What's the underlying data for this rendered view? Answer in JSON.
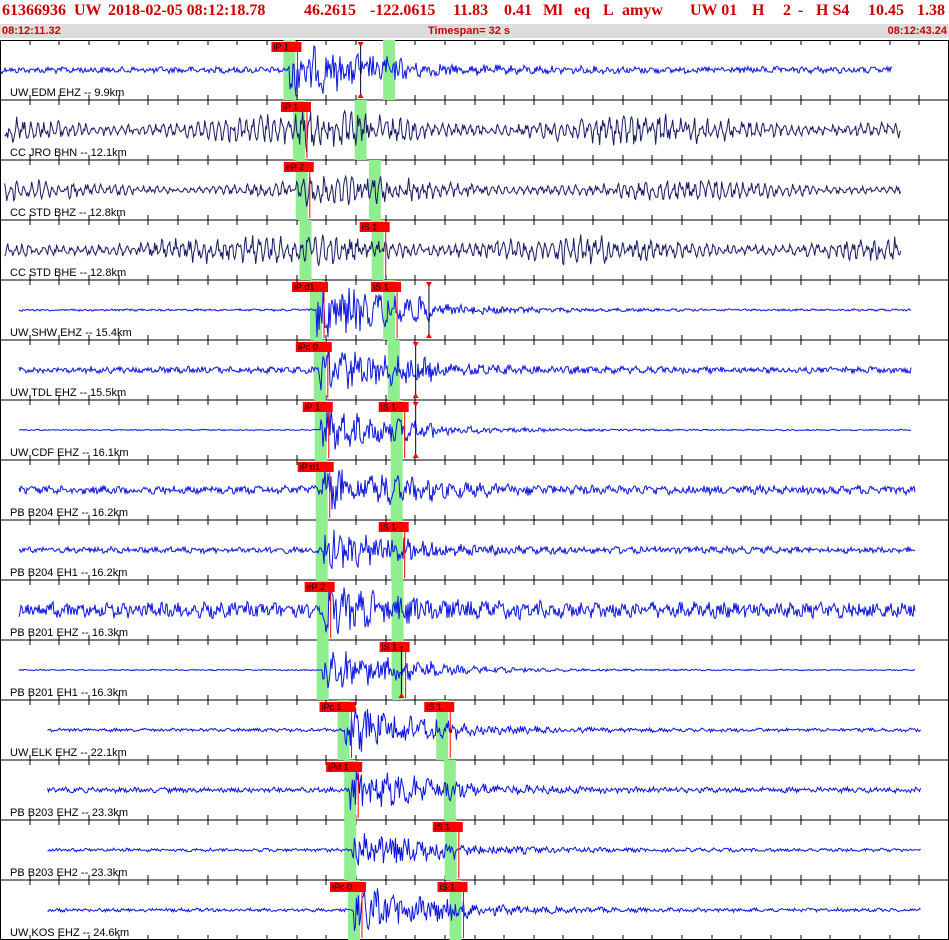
{
  "header": {
    "event_id": "61366936",
    "network": "UW",
    "datetime": "2018-02-05 08:12:18.78",
    "latitude": "46.2615",
    "longitude": "-122.0615",
    "depth": "11.83",
    "magnitude": "0.41",
    "mag_type": "Ml",
    "event_type": "eq",
    "flag": "L",
    "analyst": "amyw",
    "origin_source": "UW 01",
    "h_code": "H",
    "h_num": "2",
    "dash": "-",
    "h_s": "H S4",
    "rms": "10.45",
    "gap": "1.38"
  },
  "timebar": {
    "start_time": "08:12:11.32",
    "timespan": "Timespan=  32 s",
    "end_time": "08:12:43.24"
  },
  "colors": {
    "title": "#cc0000",
    "trace_dark": "#1a1a66",
    "trace_blue": "#0a14e0",
    "pick_flag": "#ff0000",
    "pick_window": "#90ee90"
  },
  "traces": [
    {
      "label": "UW EDM EHZ -- 9.9km",
      "p_label": "iP 1",
      "s_label": "",
      "p": 0.305,
      "s": 0.41,
      "onset": 0.38,
      "trace_start": 0.0,
      "trace_end": 0.94,
      "amp": 0.15,
      "burst": 0.9,
      "dark": false
    },
    {
      "label": "CC JRO BHN -- 12.1km",
      "p_label": "iP 1",
      "s_label": "",
      "p": 0.315,
      "s": 0.38,
      "onset": 0.0,
      "trace_start": 0.005,
      "trace_end": 0.95,
      "amp": 0.65,
      "burst": 0.25,
      "dark": true
    },
    {
      "label": "CC STD BHZ -- 12.8km",
      "p_label": "eP 2",
      "s_label": "",
      "p": 0.318,
      "s": 0.395,
      "onset": 0.0,
      "trace_start": 0.005,
      "trace_end": 0.95,
      "amp": 0.45,
      "burst": 0.3,
      "dark": true
    },
    {
      "label": "CC STD BHE -- 12.8km",
      "p_label": "",
      "s_label": "iS 1",
      "p": 0.322,
      "s": 0.398,
      "onset": 0.0,
      "trace_start": 0.005,
      "trace_end": 0.95,
      "amp": 0.6,
      "burst": 0.25,
      "dark": true
    },
    {
      "label": "UW SHW EHZ -- 15.4km",
      "p_label": "iP d1",
      "s_label": "iS 1",
      "p": 0.333,
      "s": 0.41,
      "onset": 0.452,
      "trace_start": 0.02,
      "trace_end": 0.96,
      "amp": 0.05,
      "burst": 1.1,
      "dark": false
    },
    {
      "label": "UW TDL EHZ -- 15.5km",
      "p_label": "iPc 0",
      "s_label": "",
      "p": 0.337,
      "s": 0.415,
      "onset": 0.438,
      "trace_start": 0.02,
      "trace_end": 0.96,
      "amp": 0.15,
      "burst": 0.8,
      "dark": false
    },
    {
      "label": "UW CDF EHZ -- 16.1km",
      "p_label": "iP 1",
      "s_label": "iS 1",
      "p": 0.338,
      "s": 0.418,
      "onset": 0.438,
      "trace_start": 0.02,
      "trace_end": 0.96,
      "amp": 0.03,
      "burst": 0.8,
      "dark": false
    },
    {
      "label": "PB B204 EHZ -- 16.2km",
      "p_label": "iP d1",
      "s_label": "",
      "p": 0.339,
      "s": 0.418,
      "onset": 0.0,
      "trace_start": 0.02,
      "trace_end": 0.965,
      "amp": 0.2,
      "burst": 0.7,
      "dark": false
    },
    {
      "label": "PB B204 EH1 -- 16.2km",
      "p_label": "",
      "s_label": "iS 1",
      "p": 0.339,
      "s": 0.418,
      "onset": 0.0,
      "trace_start": 0.02,
      "trace_end": 0.965,
      "amp": 0.15,
      "burst": 0.7,
      "dark": false
    },
    {
      "label": "PB B201 EHZ -- 16.3km",
      "p_label": "eP 2",
      "s_label": "",
      "p": 0.34,
      "s": 0.419,
      "onset": 0.0,
      "trace_start": 0.02,
      "trace_end": 0.965,
      "amp": 0.35,
      "burst": 0.6,
      "dark": false
    },
    {
      "label": "PB B201 EH1 -- 16.3km",
      "p_label": "",
      "s_label": "iS 1",
      "p": 0.34,
      "s": 0.419,
      "onset": 0.423,
      "trace_start": 0.02,
      "trace_end": 0.965,
      "amp": 0.03,
      "burst": 0.8,
      "dark": false
    },
    {
      "label": "UW ELK EHZ -- 22.1km",
      "p_label": "iPc 1",
      "s_label": "iS 1",
      "p": 0.362,
      "s": 0.466,
      "onset": 0.0,
      "trace_start": 0.05,
      "trace_end": 0.97,
      "amp": 0.08,
      "burst": 0.8,
      "dark": false
    },
    {
      "label": "PB B203 EHZ -- 23.3km",
      "p_label": "iPd 1",
      "s_label": "",
      "p": 0.369,
      "s": 0.474,
      "onset": 0.0,
      "trace_start": 0.05,
      "trace_end": 0.97,
      "amp": 0.12,
      "burst": 0.75,
      "dark": false
    },
    {
      "label": "PB B203 EH2 -- 23.3km",
      "p_label": "",
      "s_label": "iS 1",
      "p": 0.369,
      "s": 0.475,
      "onset": 0.0,
      "trace_start": 0.05,
      "trace_end": 0.97,
      "amp": 0.08,
      "burst": 0.7,
      "dark": false
    },
    {
      "label": "UW KOS EHZ -- 24.6km",
      "p_label": "iPc 0",
      "s_label": "iS 1",
      "p": 0.373,
      "s": 0.48,
      "onset": 0.0,
      "trace_start": 0.05,
      "trace_end": 0.97,
      "amp": 0.08,
      "burst": 0.8,
      "dark": false
    }
  ]
}
